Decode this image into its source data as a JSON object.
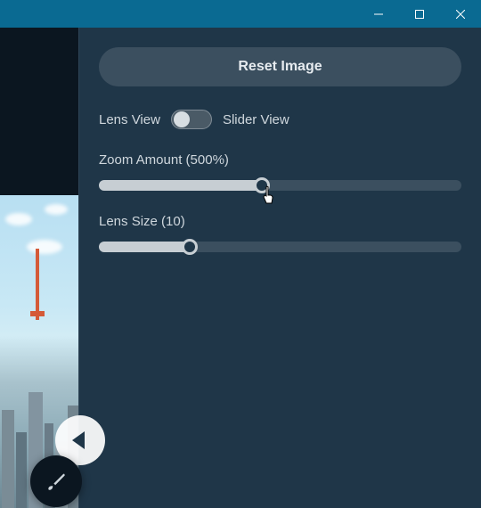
{
  "window": {
    "minimize": "minimize",
    "maximize": "maximize",
    "close": "close"
  },
  "panel": {
    "reset_label": "Reset Image",
    "lens_view_label": "Lens View",
    "slider_view_label": "Slider View",
    "view_mode": "lens",
    "zoom": {
      "label": "Zoom Amount (500%)",
      "value": 500,
      "percent_fill": 45
    },
    "lens": {
      "label": "Lens Size (10)",
      "value": 10,
      "percent_fill": 25
    }
  },
  "icons": {
    "brush": "brush-icon",
    "prev": "previous"
  },
  "colors": {
    "titlebar": "#0a6a92",
    "panel_bg": "#1f3648",
    "dark_bg": "#0b1620",
    "control_bg": "#3b4f5f",
    "slider_fill": "#c7ced3",
    "text": "#cfd7dd"
  }
}
